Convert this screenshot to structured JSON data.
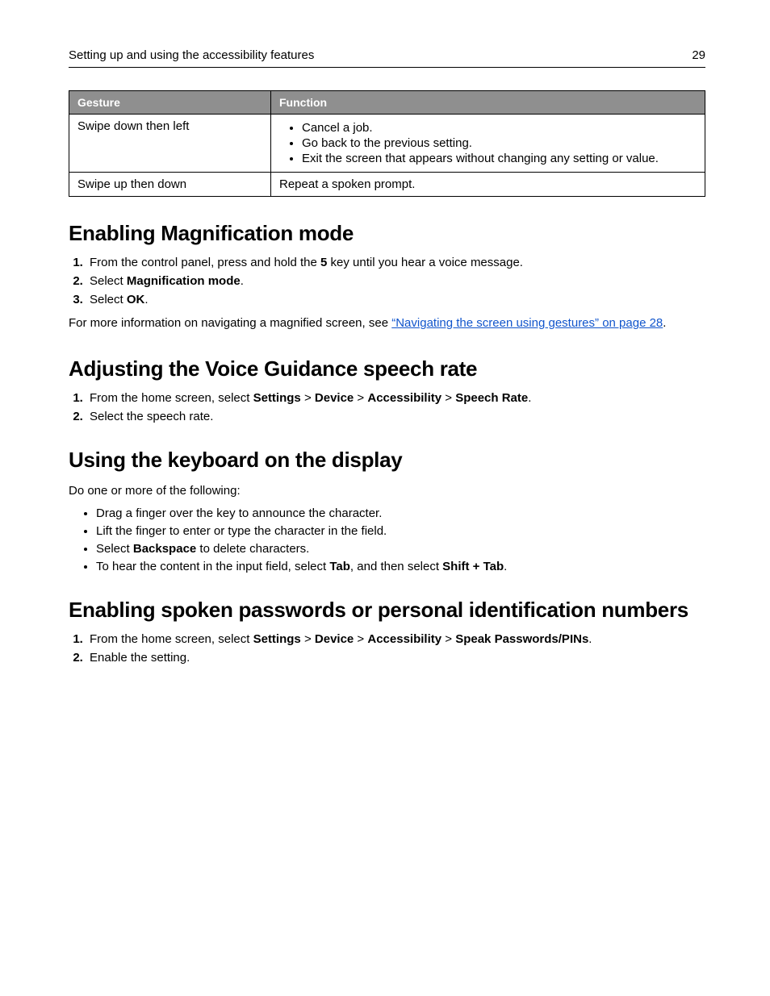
{
  "header": {
    "title": "Setting up and using the accessibility features",
    "page_number": "29"
  },
  "table": {
    "headers": {
      "gesture": "Gesture",
      "function": "Function"
    },
    "rows": [
      {
        "gesture": "Swipe down then left",
        "functions": [
          "Cancel a job.",
          "Go back to the previous setting.",
          "Exit the screen that appears without changing any setting or value."
        ]
      },
      {
        "gesture": "Swipe up then down",
        "function_text": "Repeat a spoken prompt."
      }
    ]
  },
  "sections": {
    "magnification": {
      "heading": "Enabling Magnification mode",
      "step1_pre": "From the control panel, press and hold the ",
      "step1_bold": "5",
      "step1_post": " key until you hear a voice message.",
      "step2_pre": "Select ",
      "step2_bold": "Magnification mode",
      "step2_post": ".",
      "step3_pre": "Select ",
      "step3_bold": "OK",
      "step3_post": ".",
      "more_pre": "For more information on navigating a magnified screen, see ",
      "more_link": "“Navigating the screen using gestures” on page 28",
      "more_post": "."
    },
    "speech_rate": {
      "heading": "Adjusting the Voice Guidance speech rate",
      "step1_pre": "From the home screen, select ",
      "step1_b1": "Settings",
      "sep": " > ",
      "step1_b2": "Device",
      "step1_b3": "Accessibility",
      "step1_b4": "Speech Rate",
      "step1_post": ".",
      "step2": "Select the speech rate."
    },
    "keyboard": {
      "heading": "Using the keyboard on the display",
      "intro": "Do one or more of the following:",
      "b1": "Drag a finger over the key to announce the character.",
      "b2": "Lift the finger to enter or type the character in the field.",
      "b3_pre": "Select ",
      "b3_bold": "Backspace",
      "b3_post": " to delete characters.",
      "b4_pre": "To hear the content in the input field, select ",
      "b4_b1": "Tab",
      "b4_mid": ", and then select ",
      "b4_b2": "Shift + Tab",
      "b4_post": "."
    },
    "passwords": {
      "heading": "Enabling spoken passwords or personal identification numbers",
      "step1_pre": "From the home screen, select ",
      "step1_b1": "Settings",
      "sep": " > ",
      "step1_b2": "Device",
      "step1_b3": "Accessibility",
      "step1_b4": "Speak Passwords/PINs",
      "step1_post": ".",
      "step2": "Enable the setting."
    }
  }
}
